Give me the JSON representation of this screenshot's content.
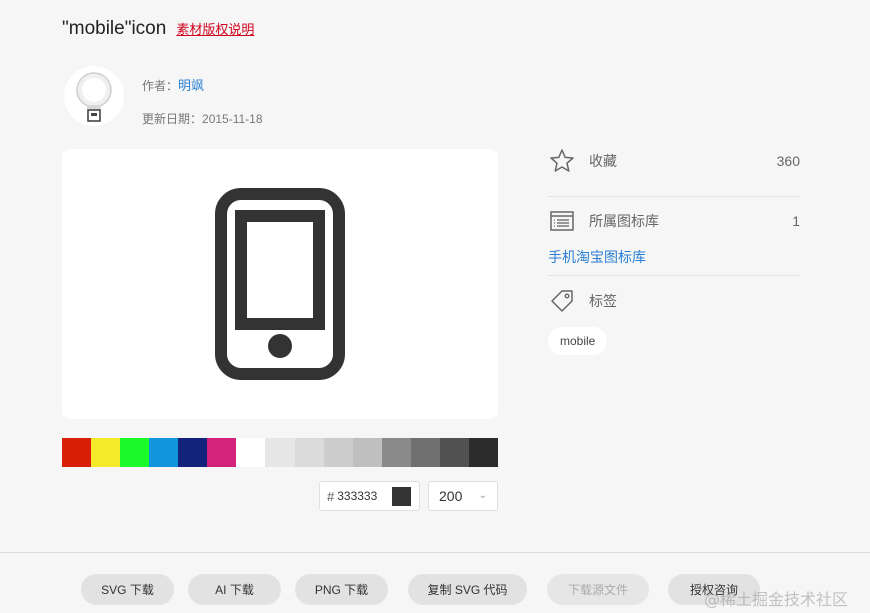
{
  "header": {
    "title": "\"mobile\"icon",
    "copyright_link": "素材版权说明"
  },
  "author": {
    "label": "作者：",
    "name": "明飒",
    "date_label": "更新日期：",
    "date": "2015-11-18"
  },
  "preview": {
    "icon": "mobile-phone-icon",
    "color": "#333333"
  },
  "palette": {
    "swatches": [
      "#d81e06",
      "#f4ea2a",
      "#1afa29",
      "#1296db",
      "#13227a",
      "#d4237a",
      "#ffffff",
      "#e6e6e6",
      "#dbdbdb",
      "#cdcdcd",
      "#bfbfbf",
      "#8a8a8a",
      "#707070",
      "#515151",
      "#2c2c2c"
    ]
  },
  "color_input": {
    "hash": "#",
    "value": "333333",
    "chip_color": "#333333"
  },
  "size_select": {
    "value": "200",
    "chevron": "⌄"
  },
  "sidebar": {
    "favorites": {
      "icon": "star-icon",
      "label": "收藏",
      "count": "360"
    },
    "libraries": {
      "icon": "library-icon",
      "label": "所属图标库",
      "count": "1",
      "link": "手机淘宝图标库"
    },
    "tags": {
      "icon": "tag-icon",
      "label": "标签",
      "items": [
        "mobile"
      ]
    }
  },
  "actions": {
    "svg_download": "SVG 下载",
    "ai_download": "AI 下载",
    "png_download": "PNG 下载",
    "copy_svg": "复制 SVG 代码",
    "source_download": "下载源文件",
    "license_inquiry": "授权咨询"
  },
  "watermark": "@稀土掘金技术社区"
}
